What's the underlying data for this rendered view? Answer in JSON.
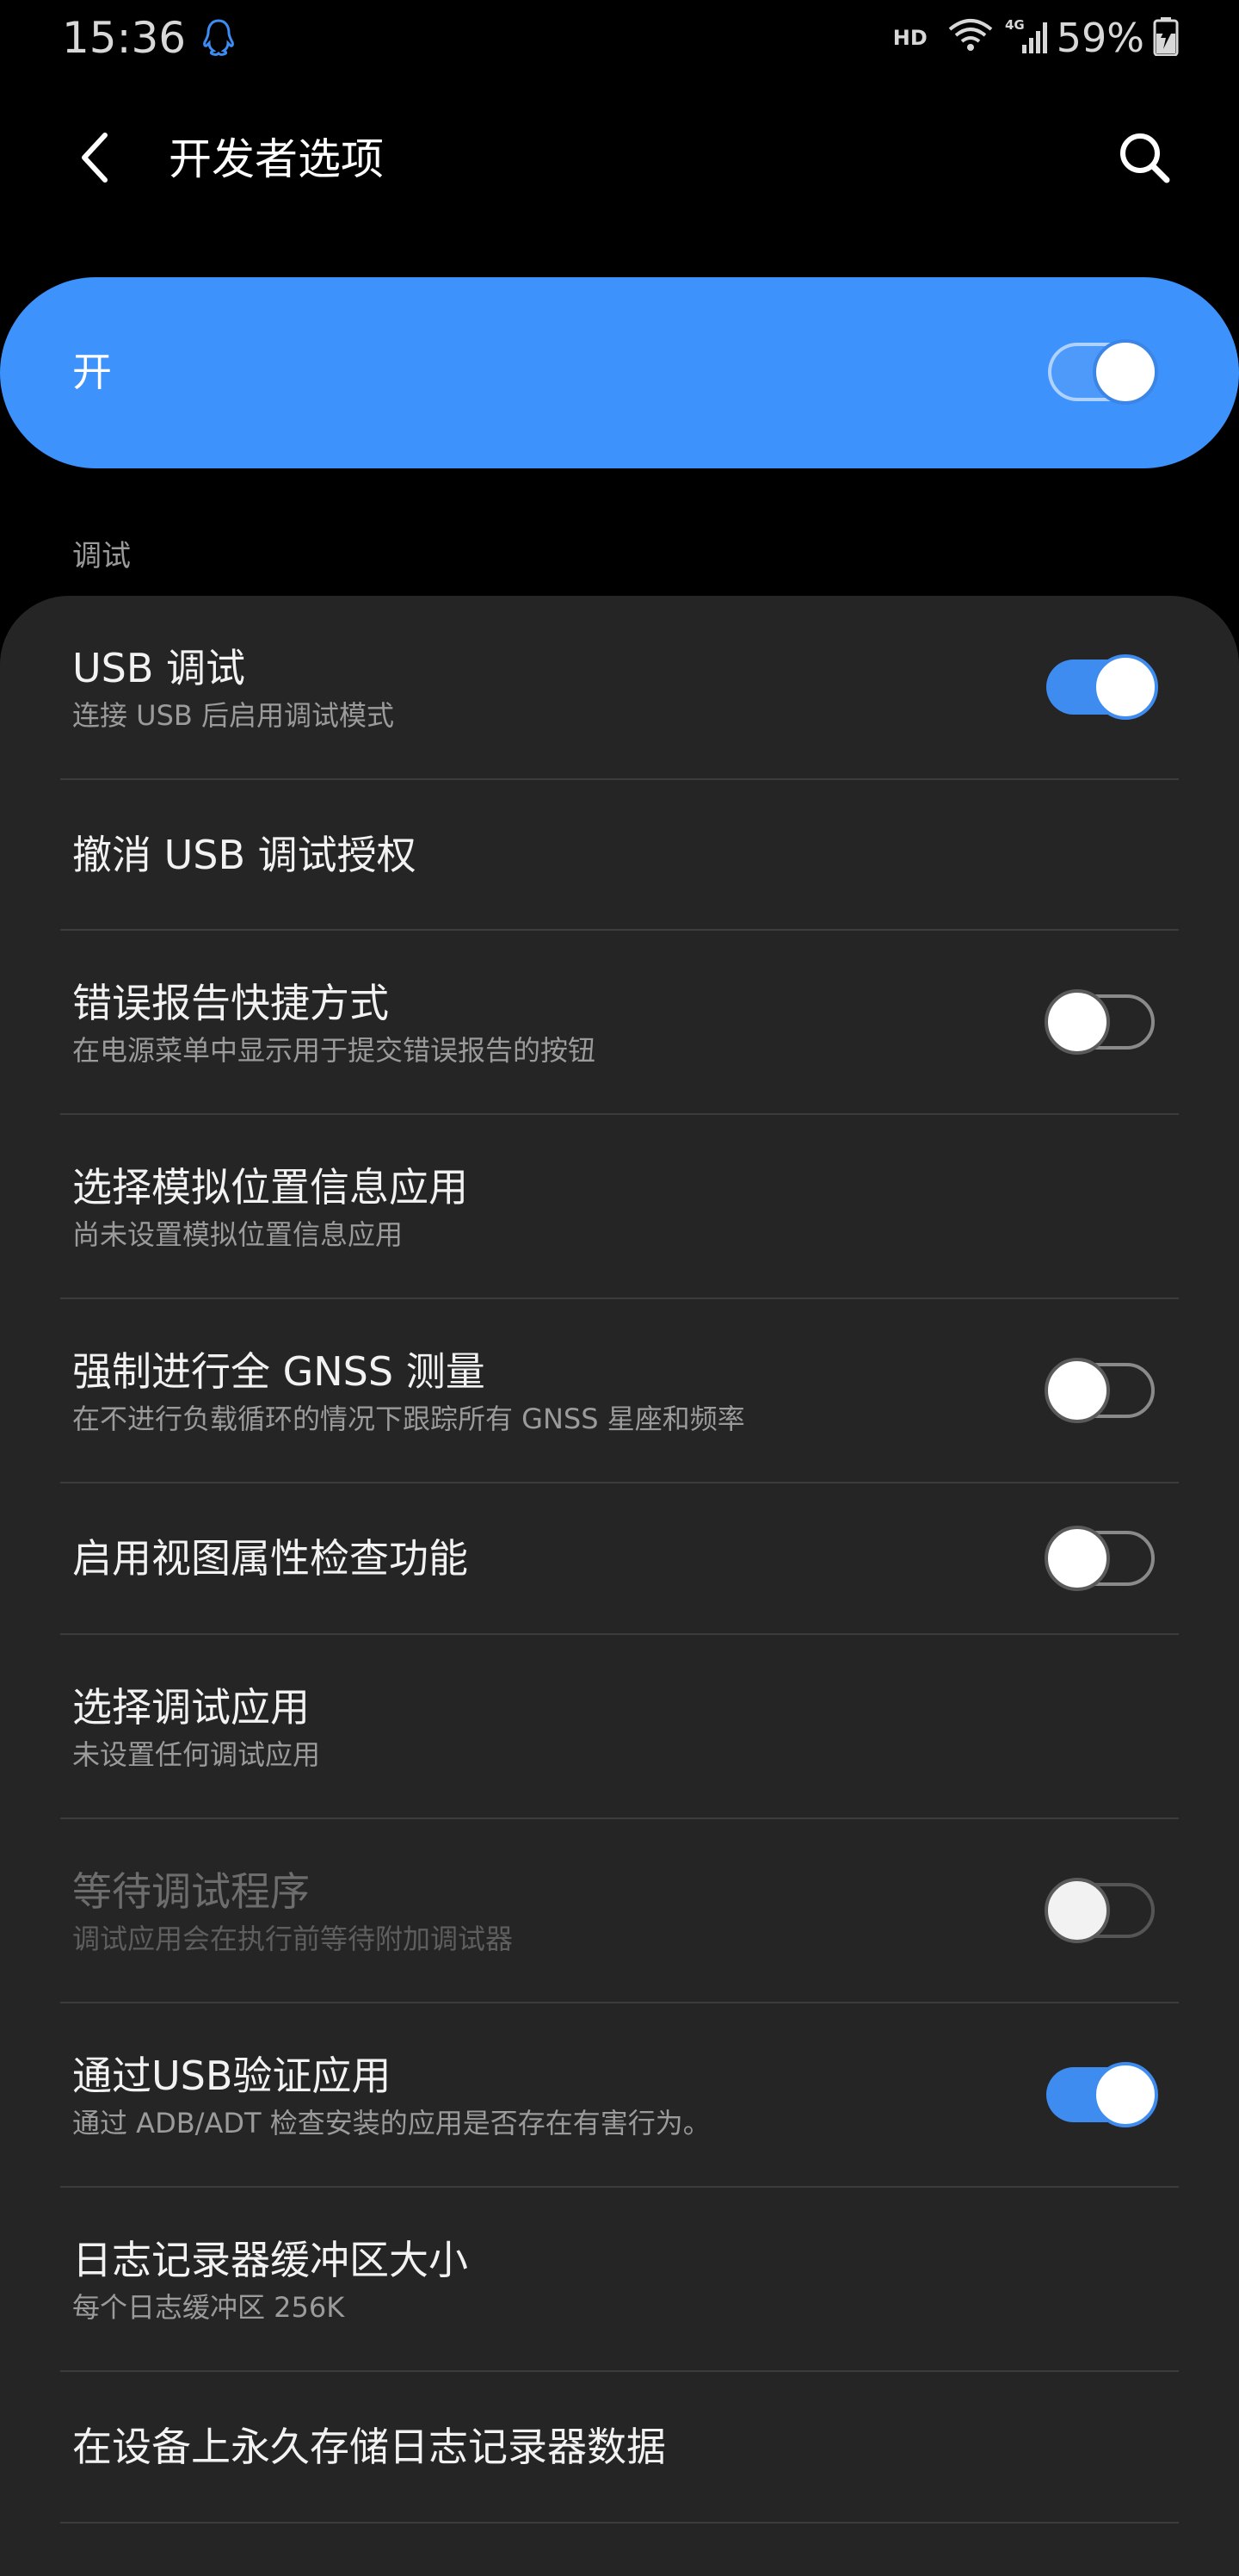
{
  "status_bar": {
    "time": "15:36",
    "notification_icon": "qq-penguin-icon",
    "hd_label": "HD",
    "network_label": "4G",
    "battery_percent": "59%"
  },
  "app_bar": {
    "title": "开发者选项",
    "back_icon": "chevron-left-icon",
    "search_icon": "search-icon"
  },
  "master_switch": {
    "label": "开",
    "state": "on"
  },
  "section": {
    "title": "调试"
  },
  "settings": [
    {
      "title": "USB 调试",
      "subtitle": "连接 USB 后启用调试模式",
      "toggle": "on",
      "enabled": true
    },
    {
      "title": "撤消 USB 调试授权",
      "subtitle": "",
      "toggle": "none",
      "enabled": true
    },
    {
      "title": "错误报告快捷方式",
      "subtitle": "在电源菜单中显示用于提交错误报告的按钮",
      "toggle": "off",
      "enabled": true
    },
    {
      "title": "选择模拟位置信息应用",
      "subtitle": "尚未设置模拟位置信息应用",
      "toggle": "none",
      "enabled": true
    },
    {
      "title": "强制进行全 GNSS 测量",
      "subtitle": "在不进行负载循环的情况下跟踪所有 GNSS 星座和频率",
      "toggle": "off",
      "enabled": true
    },
    {
      "title": "启用视图属性检查功能",
      "subtitle": "",
      "toggle": "off",
      "enabled": true
    },
    {
      "title": "选择调试应用",
      "subtitle": "未设置任何调试应用",
      "toggle": "none",
      "enabled": true
    },
    {
      "title": "等待调试程序",
      "subtitle": "调试应用会在执行前等待附加调试器",
      "toggle": "off",
      "enabled": false
    },
    {
      "title": "通过USB验证应用",
      "subtitle": "通过 ADB/ADT 检查安装的应用是否存在有害行为。",
      "toggle": "on",
      "enabled": true
    },
    {
      "title": "日志记录器缓冲区大小",
      "subtitle": "每个日志缓冲区 256K",
      "toggle": "none",
      "enabled": true
    },
    {
      "title": "在设备上永久存储日志记录器数据",
      "subtitle": "",
      "toggle": "none",
      "enabled": true
    }
  ],
  "colors": {
    "accent": "#3e92fb",
    "background": "#000000",
    "card": "#252525"
  }
}
